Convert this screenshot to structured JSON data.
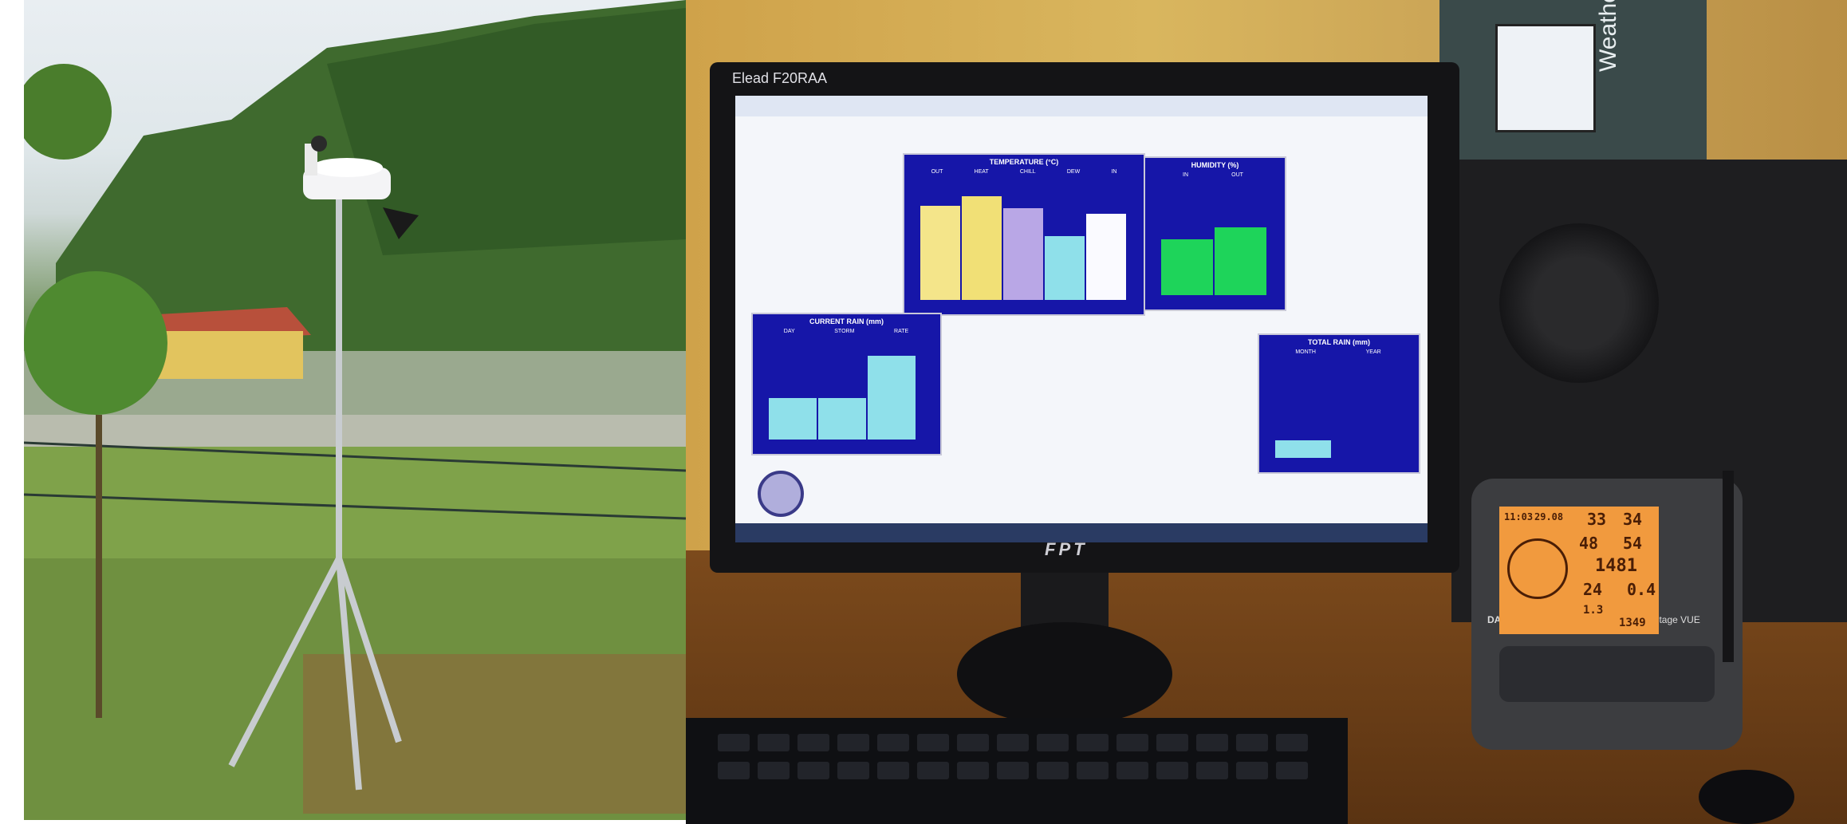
{
  "left_scene": {
    "subject": "weather station on tripod",
    "colors": {
      "sky": "#e7edf1",
      "mountain": "#4f7438",
      "grass": "#6f9440",
      "roof": "#b24a3a",
      "house": "#e0c060"
    }
  },
  "monitor": {
    "title_bar": "Elead F20RAA",
    "brand": "FPT",
    "panels": {
      "temperature": {
        "title": "TEMPERATURE (°C)",
        "labels": [
          "OUT",
          "HEAT",
          "CHILL",
          "DEW",
          "IN"
        ]
      },
      "humidity": {
        "title": "HUMIDITY (%)",
        "labels": [
          "IN",
          "OUT"
        ]
      },
      "current_rain": {
        "title": "CURRENT RAIN (mm)",
        "labels": [
          "DAY",
          "STORM",
          "RATE"
        ]
      },
      "total_rain": {
        "title": "TOTAL RAIN (mm)",
        "labels": [
          "MONTH",
          "YEAR"
        ]
      }
    },
    "colors": {
      "panel_bg": "#1616a8",
      "bar_yellow": "#f4e58a",
      "bar_purple": "#b9a7e6",
      "bar_cyan": "#8fe0ea",
      "bar_white": "#fafaff",
      "bar_green": "#1ed45a"
    }
  },
  "weatherlink_box": {
    "label": "WeatherLink"
  },
  "console": {
    "brand": "DAVIS",
    "model": "Vantage VUE",
    "lcd": {
      "time": "11:03",
      "date": "29.08",
      "temp": "33",
      "hum": "34",
      "out_hum": "48",
      "out_temp": "54",
      "baro": "1481",
      "rain_a": "24",
      "rain_b": "0.4",
      "extra_a": "1.3",
      "extra_b": "1349"
    }
  }
}
